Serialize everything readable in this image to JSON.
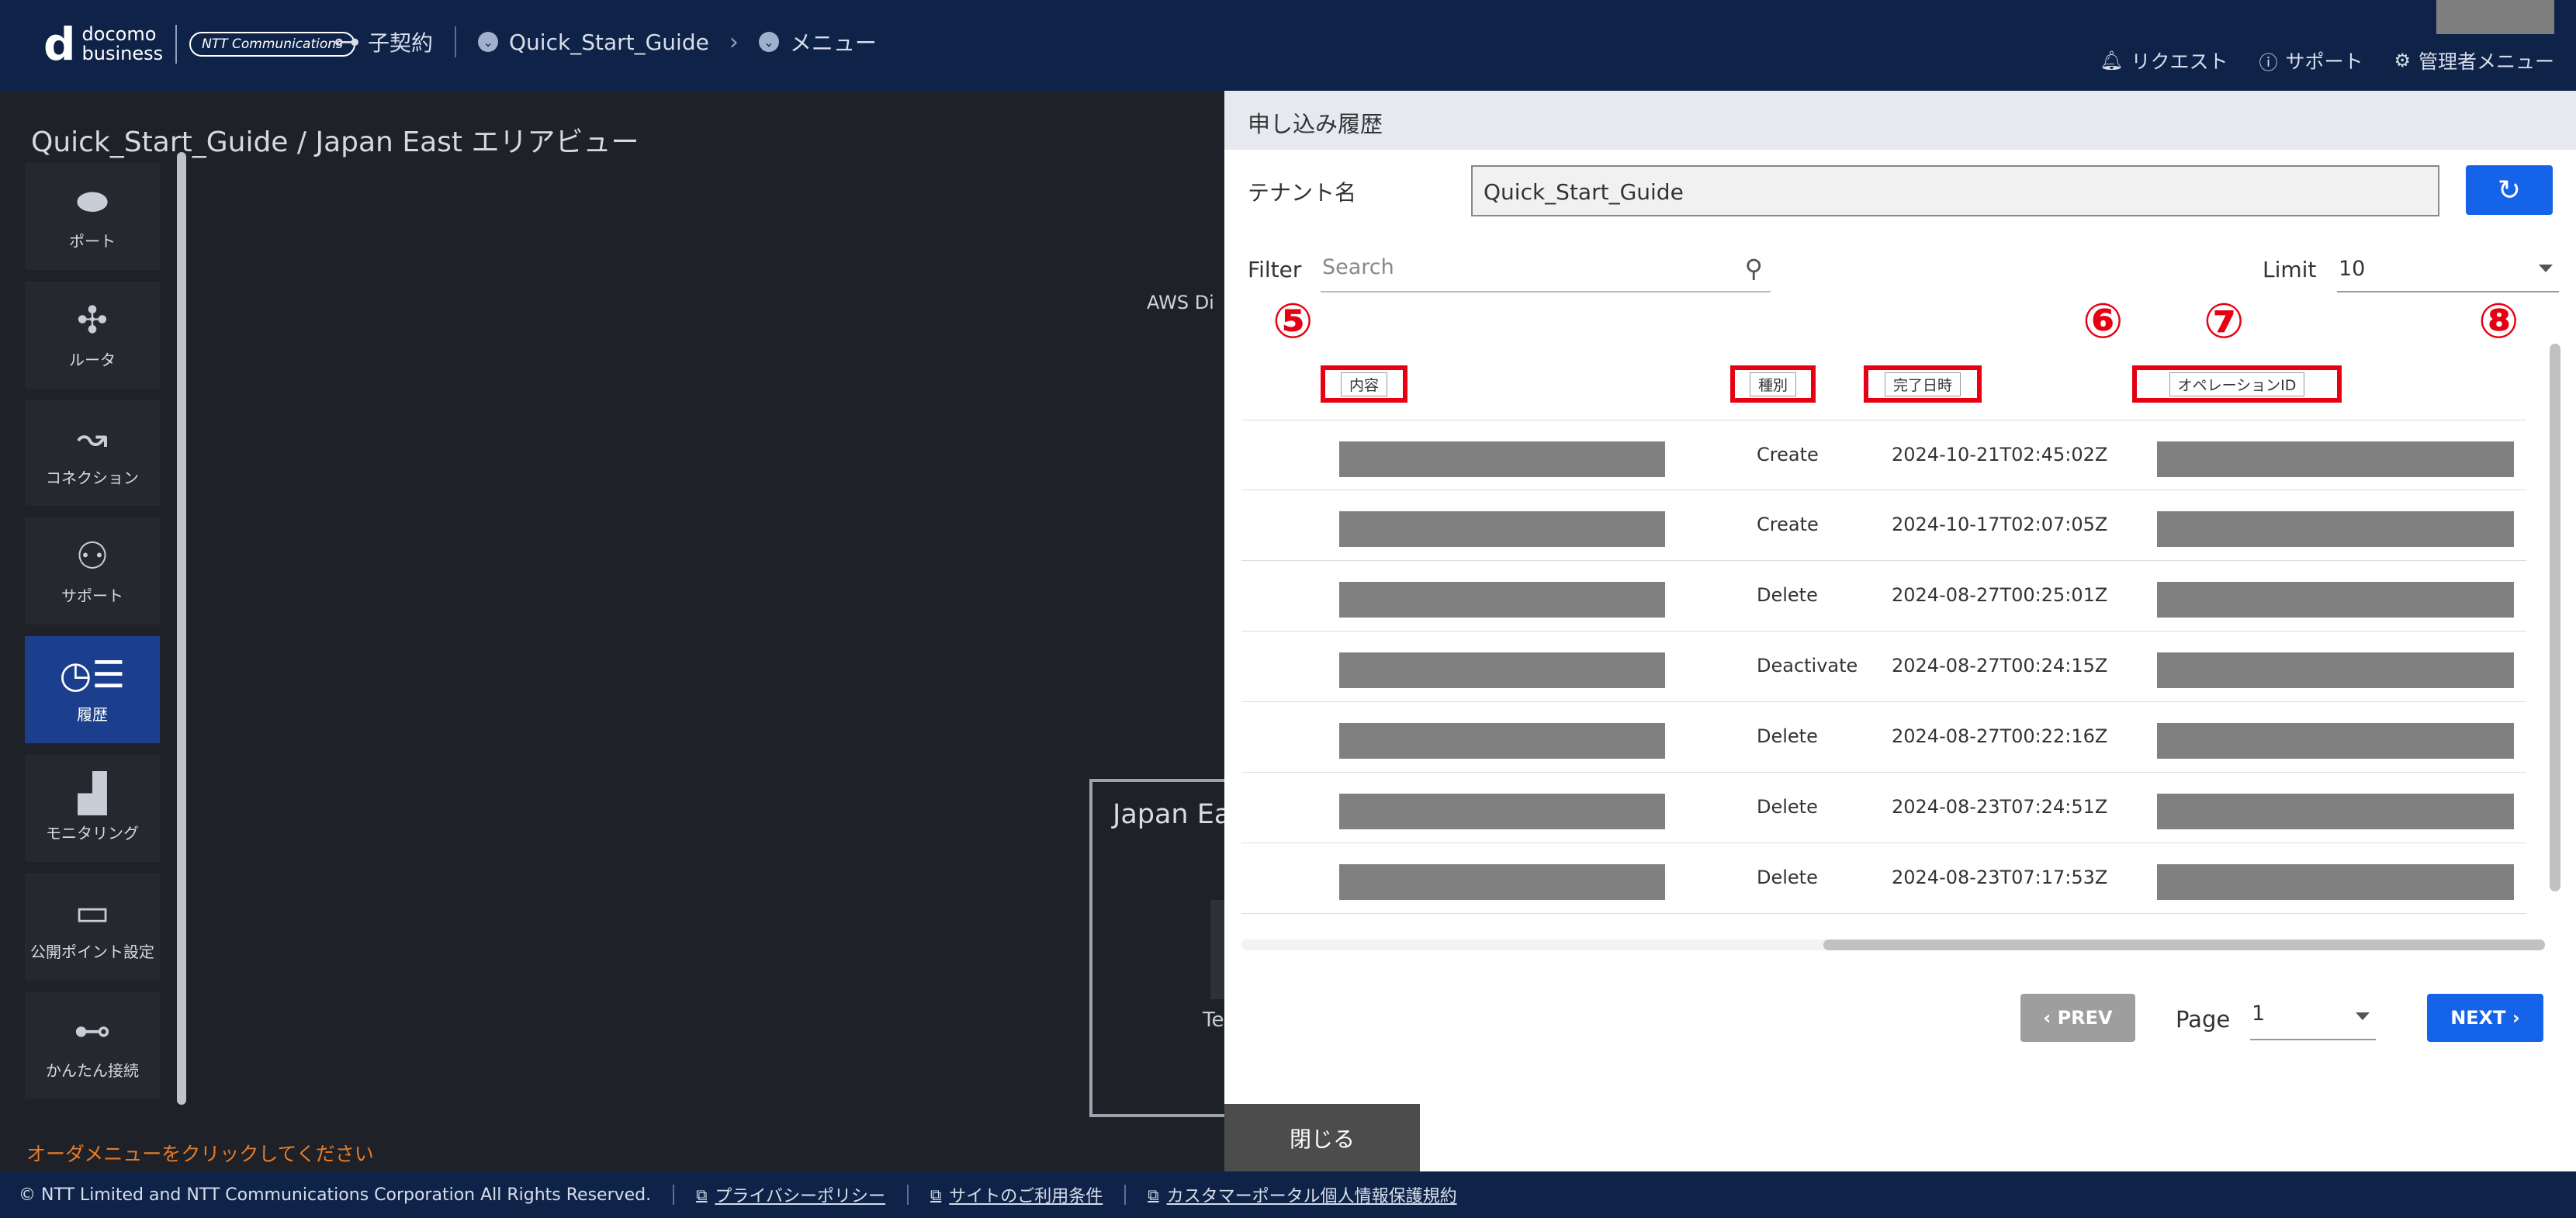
{
  "header": {
    "brand_top": "docomo",
    "brand_bottom": "business",
    "brand_partner": "NTT Communications",
    "contract": "子契約",
    "tenant": "Quick_Start_Guide",
    "menu": "メニュー",
    "request": "リクエスト",
    "support": "サポート",
    "admin_menu": "管理者メニュー"
  },
  "area": {
    "title": "Quick_Start_Guide / Japan East エリアビュー",
    "aws_label": "AWS Di",
    "region_box_title": "Japan Ea",
    "region_box_sub": "Te",
    "order_hint": "オーダメニューをクリックしてください"
  },
  "sidebar": {
    "items": [
      {
        "label": "ポート",
        "icon": "port-icon"
      },
      {
        "label": "ルータ",
        "icon": "router-icon"
      },
      {
        "label": "コネクション",
        "icon": "connection-icon"
      },
      {
        "label": "サポート",
        "icon": "support-user-icon"
      },
      {
        "label": "履歴",
        "icon": "history-icon"
      },
      {
        "label": "モニタリング",
        "icon": "monitoring-icon"
      },
      {
        "label": "公開ポイント設定",
        "icon": "public-point-icon"
      },
      {
        "label": "かんたん接続",
        "icon": "easy-connect-icon"
      }
    ]
  },
  "panel": {
    "title": "申し込み履歴",
    "tenant_label": "テナント名",
    "tenant_value": "Quick_Start_Guide",
    "filter_label": "Filter",
    "search_placeholder": "Search",
    "limit_label": "Limit",
    "limit_value": "10",
    "markers": [
      "⑤",
      "⑥",
      "⑦",
      "⑧"
    ],
    "columns": [
      "内容",
      "種別",
      "完了日時",
      "オペレーションID"
    ],
    "rows": [
      {
        "type": "Create",
        "date": "2024-10-21T02:45:02Z"
      },
      {
        "type": "Create",
        "date": "2024-10-17T02:07:05Z"
      },
      {
        "type": "Delete",
        "date": "2024-08-27T00:25:01Z"
      },
      {
        "type": "Deactivate",
        "date": "2024-08-27T00:24:15Z"
      },
      {
        "type": "Delete",
        "date": "2024-08-27T00:22:16Z"
      },
      {
        "type": "Delete",
        "date": "2024-08-23T07:24:51Z"
      },
      {
        "type": "Delete",
        "date": "2024-08-23T07:17:53Z"
      }
    ],
    "prev_label": "PREV",
    "page_label": "Page",
    "page_value": "1",
    "next_label": "NEXT",
    "close_label": "閉じる"
  },
  "footer": {
    "copyright": "© NTT Limited and NTT Communications Corporation All Rights Reserved.",
    "privacy": "プライバシーポリシー",
    "terms": "サイトのご利用条件",
    "customer_policy": "カスタマーポータル個人情報保護規約"
  },
  "colors": {
    "header_bg": "#0f2349",
    "accent_blue": "#1463e8",
    "marker_red": "#e80012",
    "hint_orange": "#e87b27"
  }
}
